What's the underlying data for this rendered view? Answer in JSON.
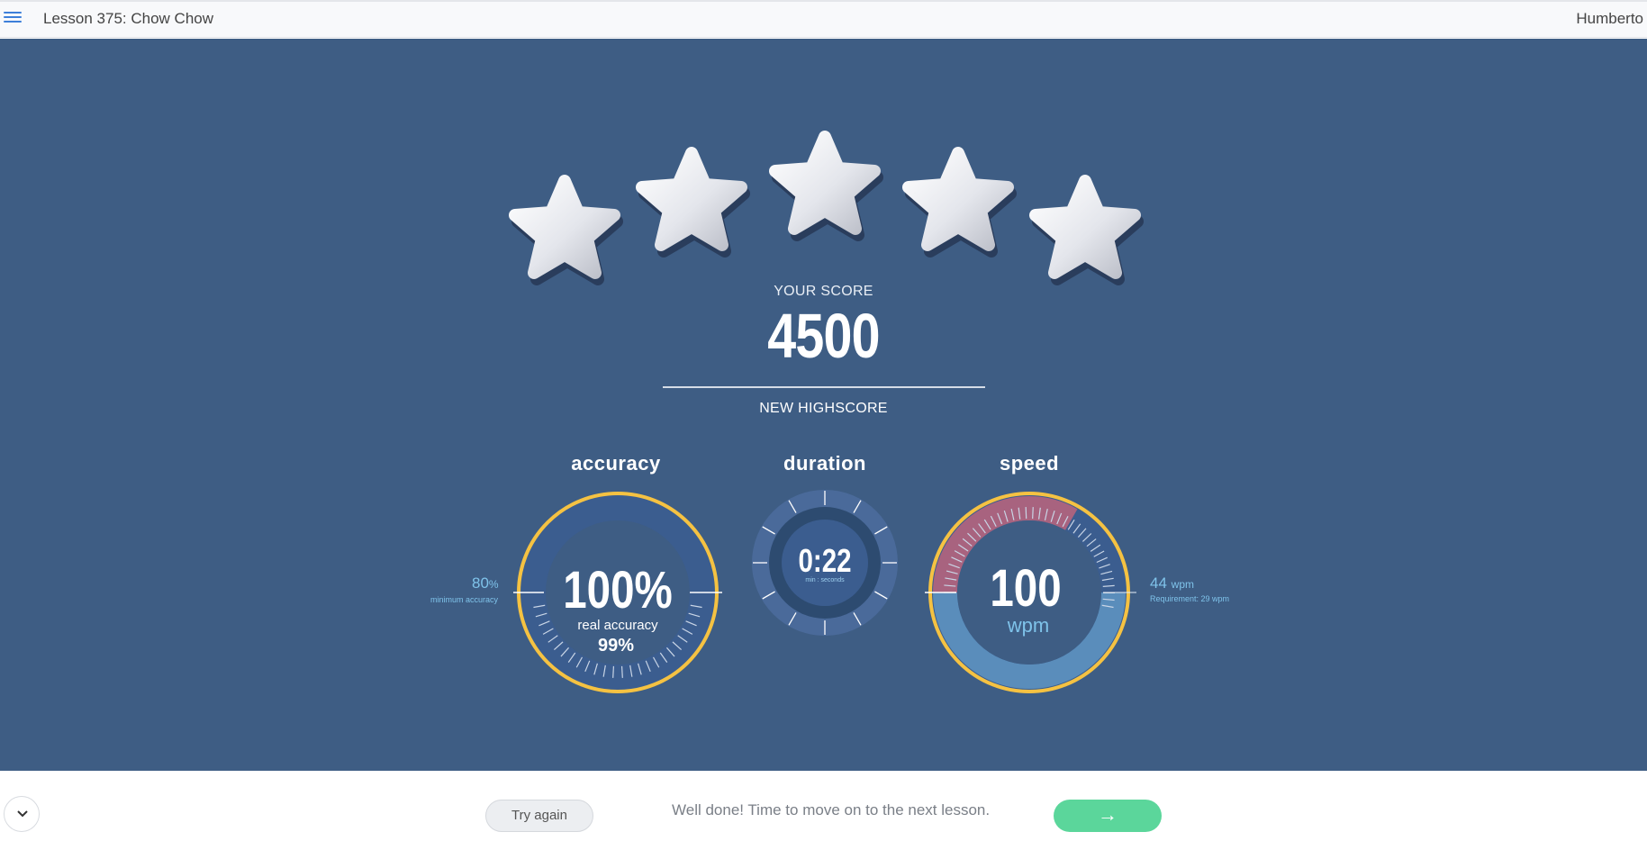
{
  "header": {
    "lesson_title": "Lesson 375: Chow Chow",
    "user_name": "Humberto",
    "menu_icon": "hamburger-menu-icon"
  },
  "rating": {
    "stars_earned": 5,
    "stars_total": 5
  },
  "score": {
    "label": "YOUR SCORE",
    "value": "4500",
    "highscore_label": "NEW HIGHSCORE"
  },
  "accuracy": {
    "title": "accuracy",
    "value": "100%",
    "real_label": "real accuracy",
    "real_value": "99%",
    "min_value": "80",
    "min_unit": "%",
    "min_label": "minimum accuracy"
  },
  "duration": {
    "title": "duration",
    "value": "0:22",
    "unit_label": "min : seconds"
  },
  "speed": {
    "title": "speed",
    "value": "100",
    "unit": "wpm",
    "req_value": "44",
    "req_unit": "wpm",
    "req_label": "Requirement: 29 wpm"
  },
  "footer": {
    "try_again_label": "Try again",
    "message": "Well done! Time to move on to the next lesson.",
    "next_label": "→",
    "collapse_icon": "chevron-down-icon"
  },
  "colors": {
    "background": "#3e5d84",
    "ring": "#f5c242",
    "accent_blue": "#7fc3ea",
    "speed_fill": "#5a8dbb",
    "speed_pink": "#a8637f",
    "next_button": "#5bd69b"
  }
}
